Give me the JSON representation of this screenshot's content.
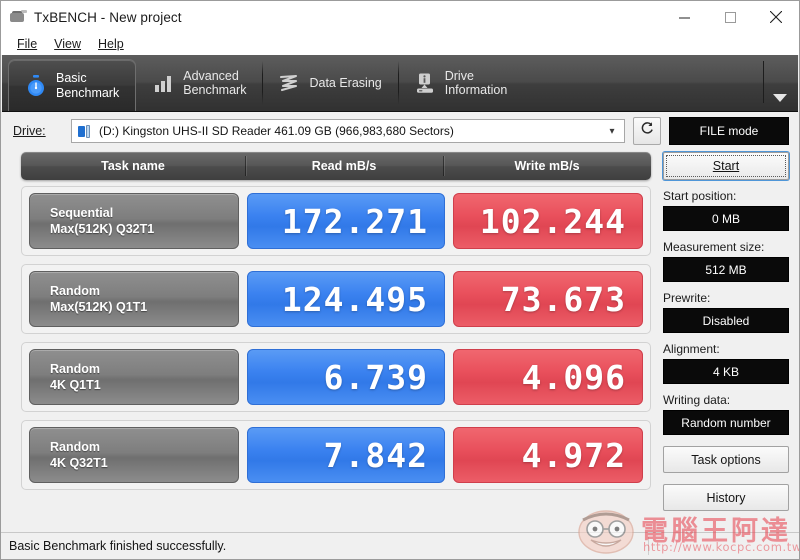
{
  "window": {
    "title": "TxBENCH - New project",
    "app_icon": "drive-app-icon",
    "controls": {
      "minimize": "minimize-icon",
      "maximize": "maximize-icon",
      "close": "close-icon"
    }
  },
  "menubar": {
    "items": [
      {
        "label": "File",
        "accel": "F"
      },
      {
        "label": "View",
        "accel": "V"
      },
      {
        "label": "Help",
        "accel": "H"
      }
    ]
  },
  "tabs": [
    {
      "label": "Basic\nBenchmark",
      "icon": "stopwatch-icon",
      "active": true
    },
    {
      "label": "Advanced\nBenchmark",
      "icon": "bar-chart-icon",
      "active": false
    },
    {
      "label": "Data Erasing",
      "icon": "eraser-wave-icon",
      "active": false
    },
    {
      "label": "Drive\nInformation",
      "icon": "drive-info-icon",
      "active": false
    }
  ],
  "tab_overflow_icon": "chevron-down-icon",
  "drive_row": {
    "label": "Drive:",
    "label_accel": "D",
    "selected": "(D:) Kingston UHS-II SD Reader  461.09 GB (966,983,680 Sectors)",
    "drive_icon": "removable-drive-icon",
    "dropdown_icon": "chevron-down-icon",
    "refresh_icon": "refresh-icon",
    "mode_button": "FILE mode"
  },
  "table": {
    "headers": [
      "Task name",
      "Read mB/s",
      "Write mB/s"
    ],
    "rows": [
      {
        "task": "Sequential\nMax(512K) Q32T1",
        "read": "172.271",
        "write": "102.244"
      },
      {
        "task": "Random\nMax(512K) Q1T1",
        "read": "124.495",
        "write": "73.673"
      },
      {
        "task": "Random\n4K Q1T1",
        "read": "6.739",
        "write": "4.096"
      },
      {
        "task": "Random\n4K Q32T1",
        "read": "7.842",
        "write": "4.972"
      }
    ]
  },
  "panel": {
    "start_button": "Start",
    "start_accel": "S",
    "fields": [
      {
        "label": "Start position:",
        "value": "0 MB"
      },
      {
        "label": "Measurement size:",
        "value": "512 MB"
      },
      {
        "label": "Prewrite:",
        "value": "Disabled"
      },
      {
        "label": "Alignment:",
        "value": "4 KB"
      },
      {
        "label": "Writing data:",
        "value": "Random number"
      }
    ],
    "task_options_button": "Task options",
    "task_options_accel": "T",
    "history_button": "History",
    "history_accel": "i"
  },
  "statusbar": {
    "message": "Basic Benchmark finished successfully."
  },
  "watermark": {
    "text": "電腦王阿達",
    "url": "http://www.kocpc.com.tw",
    "face": "cartoon-face-icon"
  },
  "colors": {
    "read": "#3b82f0",
    "write": "#e9505c",
    "accent": "#1f6fd0",
    "tabstrip": "#4a4a4a"
  },
  "chart_data": {
    "type": "bar",
    "title": "TxBENCH Basic Benchmark results",
    "categories": [
      "Sequential Max(512K) Q32T1",
      "Random Max(512K) Q1T1",
      "Random 4K Q1T1",
      "Random 4K Q32T1"
    ],
    "series": [
      {
        "name": "Read mB/s",
        "values": [
          172.271,
          124.495,
          6.739,
          7.842
        ]
      },
      {
        "name": "Write mB/s",
        "values": [
          102.244,
          73.673,
          4.096,
          4.972
        ]
      }
    ],
    "xlabel": "Task name",
    "ylabel": "mB/s",
    "legend": "top"
  }
}
